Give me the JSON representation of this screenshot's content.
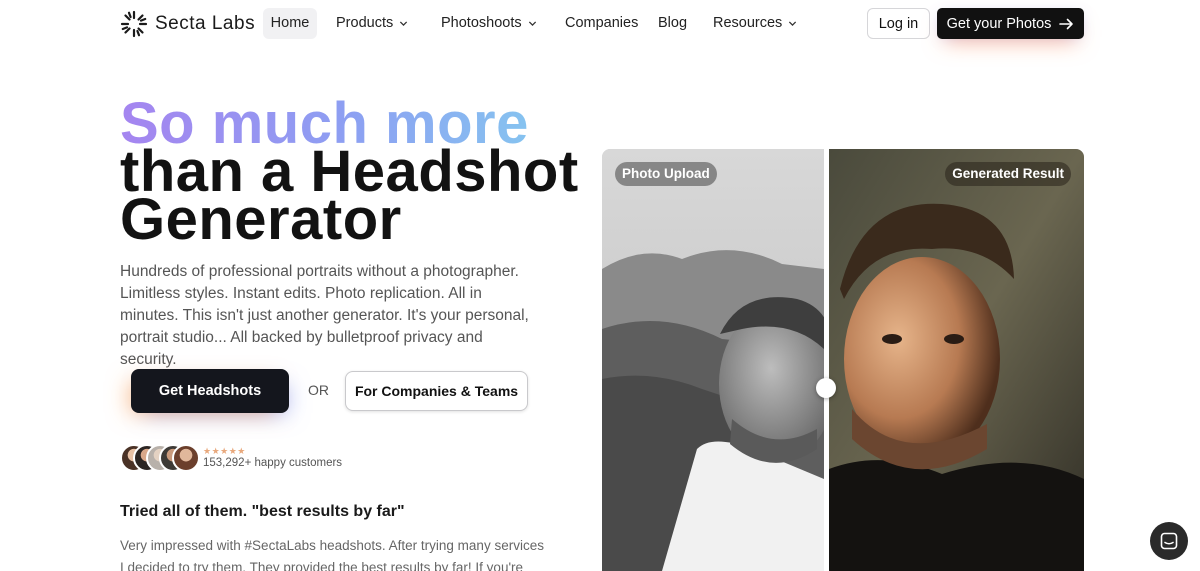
{
  "nav": {
    "brand": "Secta Labs",
    "items": [
      {
        "label": "Home"
      },
      {
        "label": "Products"
      },
      {
        "label": "Photoshoots"
      },
      {
        "label": "Companies"
      },
      {
        "label": "Blog"
      },
      {
        "label": "Resources"
      }
    ],
    "login_label": "Log in",
    "cta_label": "Get your Photos"
  },
  "hero": {
    "headline_line1": "So much more",
    "headline_line2": "than a Headshot",
    "headline_line3": "Generator",
    "description": "Hundreds of professional portraits without a photographer. Limitless styles. Instant edits. Photo replication. All in minutes. This isn't just another generator. It's your personal, portrait studio... All backed by bulletproof privacy and security.",
    "primary_button": "Get Headshots",
    "or_text": "OR",
    "secondary_button": "For Companies & Teams",
    "rating_stars": "★★★★★",
    "customers_text": "153,292+ happy customers"
  },
  "review": {
    "title": "Tried all of them. \"best results by far\"",
    "body": "Very impressed with #SectaLabs headshots. After trying many services I decided to try them. They provided the best results by far! If you're"
  },
  "comparison": {
    "left_label": "Photo Upload",
    "right_label": "Generated Result"
  },
  "colors": {
    "headline_gradient_start": "#a585f0",
    "headline_gradient_end": "#86c3f0",
    "dark_button": "#14161d"
  }
}
